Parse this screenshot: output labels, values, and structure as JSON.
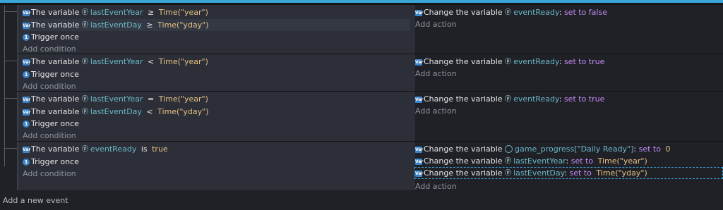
{
  "events": [
    {
      "conditions": [
        {
          "type": "var",
          "label": "The variable",
          "variable": "lastEventYear",
          "op": "≥",
          "value": "Time(\"year\")",
          "selected": false
        },
        {
          "type": "var",
          "label": "The variable",
          "variable": "lastEventDay",
          "op": "≥",
          "value": "Time(\"yday\")",
          "selected": true
        },
        {
          "type": "trigger",
          "label": "Trigger once"
        }
      ],
      "add_condition": "Add condition",
      "actions": [
        {
          "label": "Change the variable",
          "variable": "eventReady",
          "sep": ":",
          "verb": "set to false",
          "value": ""
        }
      ],
      "add_action": "Add action"
    },
    {
      "conditions": [
        {
          "type": "var",
          "label": "The variable",
          "variable": "lastEventYear",
          "op": "<",
          "value": "Time(\"year\")"
        },
        {
          "type": "trigger",
          "label": "Trigger once"
        }
      ],
      "add_condition": "Add condition",
      "actions": [
        {
          "label": "Change the variable",
          "variable": "eventReady",
          "sep": ":",
          "verb": "set to true",
          "value": ""
        }
      ],
      "add_action": "Add action"
    },
    {
      "conditions": [
        {
          "type": "var",
          "label": "The variable",
          "variable": "lastEventYear",
          "op": "=",
          "value": "Time(\"year\")"
        },
        {
          "type": "var",
          "label": "The variable",
          "variable": "lastEventDay",
          "op": "<",
          "value": "Time(\"yday\")"
        },
        {
          "type": "trigger",
          "label": "Trigger once"
        }
      ],
      "add_condition": "Add condition",
      "actions": [
        {
          "label": "Change the variable",
          "variable": "eventReady",
          "sep": ":",
          "verb": "set to true",
          "value": ""
        }
      ],
      "add_action": "Add action"
    },
    {
      "conditions": [
        {
          "type": "var",
          "label": "The variable",
          "variable": "eventReady",
          "op": "is",
          "value": "true"
        },
        {
          "type": "trigger",
          "label": "Trigger once"
        }
      ],
      "add_condition": "Add condition",
      "actions": [
        {
          "label": "Change the variable",
          "variable": "game_progress[\"Daily Ready\"]",
          "global": true,
          "sep": ":",
          "verb": "set to",
          "value": "0"
        },
        {
          "label": "Change the variable",
          "variable": "lastEventYear",
          "sep": ":",
          "verb": "set to",
          "value": "Time(\"year\")"
        },
        {
          "label": "Change the variable",
          "variable": "lastEventDay",
          "sep": ":",
          "verb": "set to",
          "value": "Time(\"yday\")",
          "dashed": true
        }
      ],
      "add_action": "Add action"
    }
  ],
  "icons": {
    "variable": "Var",
    "trigger": "1"
  },
  "add_event": "Add a new event",
  "colors": {
    "accent": "#3aa6d8",
    "variable": "#6ab7c7",
    "value": "#e7c084",
    "keyword": "#c58af2"
  }
}
